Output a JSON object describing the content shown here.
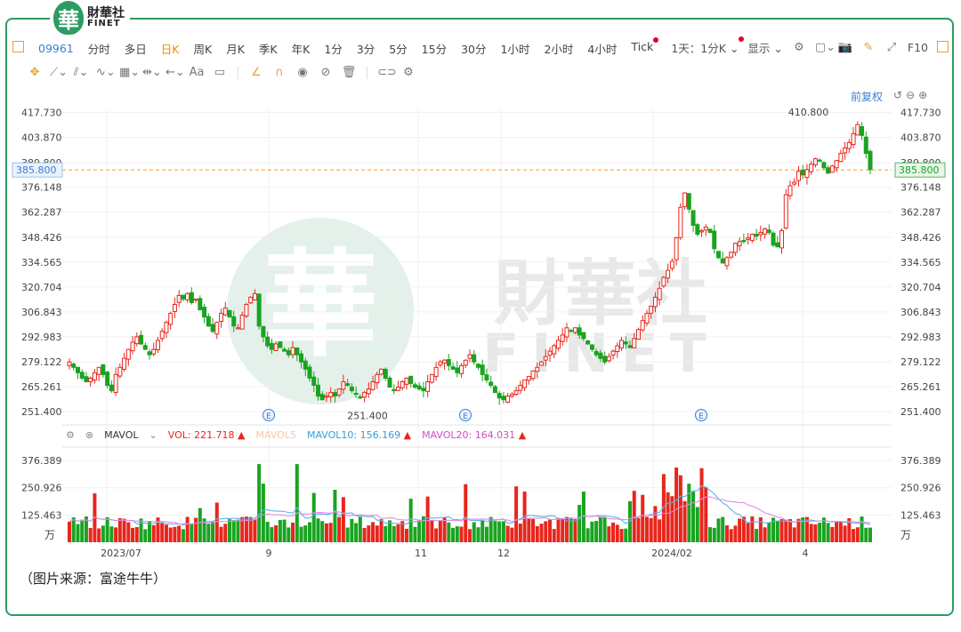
{
  "brand": {
    "badge": "華",
    "name_cn": "財華社",
    "name_en": "FINET"
  },
  "toolbar": {
    "symbol": "09961",
    "periods": [
      "分时",
      "多日",
      "日K",
      "周K",
      "月K",
      "季K",
      "年K",
      "1分",
      "3分",
      "5分",
      "15分",
      "30分",
      "1小时",
      "2小时",
      "4小时",
      "Tick"
    ],
    "active_period": "日K",
    "day_label": "1天：1分K",
    "display_label": "显示",
    "right_label": "F10"
  },
  "restore_label": "前复权",
  "price_axis": {
    "ticks": [
      "417.730",
      "403.870",
      "389.800",
      "376.148",
      "362.287",
      "348.426",
      "334.565",
      "320.704",
      "306.843",
      "292.983",
      "279.122",
      "265.261",
      "251.400"
    ],
    "current": "385.800"
  },
  "annotations": {
    "high": "410.800",
    "low": "251.400"
  },
  "volume": {
    "indicator": "MAVOL",
    "vol": "VOL: 221.718",
    "mavol5": "MAVOL5",
    "mavol10": "MAVOL10: 156.169",
    "mavol20": "MAVOL20: 164.031",
    "ticks": [
      "376.389",
      "250.926",
      "125.463"
    ],
    "unit": "万"
  },
  "x_axis": {
    "labels": [
      "2023/07",
      "9",
      "11",
      "12",
      "2024/02",
      "4"
    ]
  },
  "caption": "（图片来源：富途牛牛）",
  "colors": {
    "up": "#e8261c",
    "down": "#1aa321",
    "accent": "#2e9b63",
    "link": "#3b7fd1",
    "active": "#f08c00",
    "ma10": "#5bb4e8",
    "ma20": "#e58ae2"
  },
  "chart_data": {
    "type": "candlestick",
    "title": "",
    "ylim": [
      245,
      420
    ],
    "x_labels": [
      "2023/07",
      "9",
      "11",
      "12",
      "2024/02",
      "4"
    ],
    "closes": [
      279,
      276,
      273,
      270,
      268,
      270,
      273,
      276,
      272,
      266,
      263,
      272,
      276,
      281,
      286,
      290,
      293,
      289,
      286,
      283,
      286,
      291,
      296,
      301,
      306,
      311,
      316,
      314,
      317,
      312,
      314,
      308,
      304,
      299,
      296,
      301,
      306,
      309,
      304,
      299,
      298,
      305,
      311,
      315,
      317,
      299,
      293,
      288,
      286,
      289,
      287,
      285,
      283,
      287,
      283,
      279,
      275,
      270,
      266,
      260,
      258,
      260,
      262,
      260,
      264,
      268,
      266,
      263,
      261,
      259,
      262,
      264,
      268,
      272,
      275,
      270,
      265,
      263,
      265,
      268,
      270,
      267,
      265,
      264,
      263,
      268,
      272,
      276,
      279,
      280,
      277,
      275,
      273,
      277,
      280,
      283,
      279,
      276,
      272,
      269,
      266,
      262,
      259,
      258,
      260,
      261,
      263,
      266,
      269,
      271,
      274,
      276,
      279,
      282,
      285,
      288,
      291,
      294,
      298,
      296,
      298,
      294,
      292,
      289,
      286,
      283,
      281,
      279,
      282,
      285,
      288,
      291,
      289,
      287,
      292,
      297,
      302,
      306,
      310,
      315,
      320,
      326,
      330,
      335,
      348,
      365,
      373,
      364,
      355,
      350,
      352,
      354,
      351,
      342,
      337,
      334,
      337,
      340,
      345,
      346,
      346,
      348,
      350,
      349,
      351,
      353,
      351,
      344,
      343,
      352,
      372,
      377,
      379,
      385,
      383,
      386,
      389,
      392,
      391,
      387,
      384,
      388,
      391,
      395,
      398,
      401,
      406,
      411,
      405,
      395,
      386
    ]
  }
}
